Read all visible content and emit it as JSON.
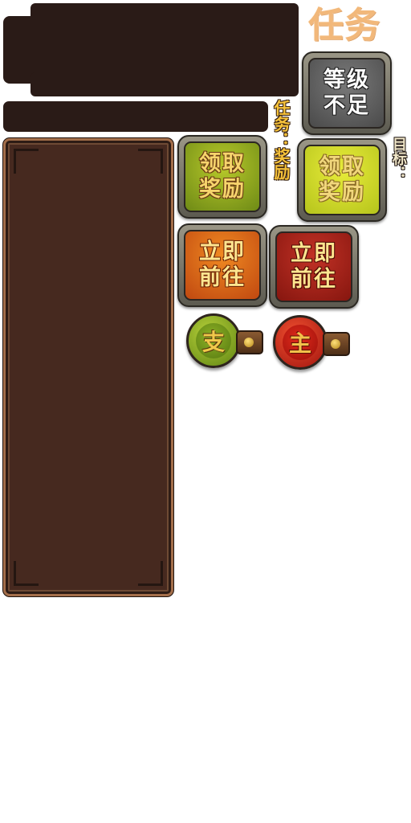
{
  "header": {
    "title": "任务"
  },
  "labels": {
    "task_reward": "任务：奖励",
    "goal": "目标："
  },
  "buttons": {
    "level_insufficient": "等级\n不足",
    "claim_reward_green": "领取\n奖励",
    "claim_reward_lime": "领取\n奖励",
    "go_now_orange": "立即\n前往",
    "go_now_red": "立即\n前往"
  },
  "orbs": {
    "side_quest": "支",
    "main_quest": "主"
  },
  "colors": {
    "panel_background": "#46291f",
    "dark_bar": "#2a1b17",
    "title_color": "#f2b87a",
    "task_label_color": "#f6c23a"
  }
}
